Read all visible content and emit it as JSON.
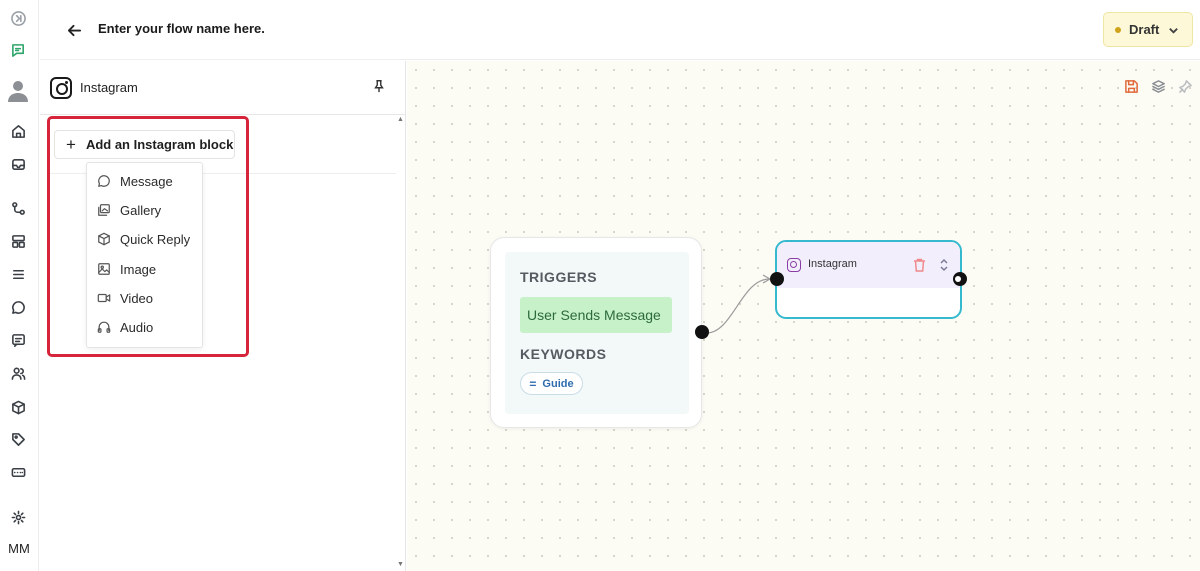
{
  "header": {
    "flow_name": "Enter your flow name here.",
    "status": "Draft"
  },
  "rail": {
    "user_initials": "MM"
  },
  "panel": {
    "title": "Instagram",
    "add_block_label": "Add an Instagram block",
    "block_types": [
      {
        "label": "Message",
        "icon": "message-icon"
      },
      {
        "label": "Gallery",
        "icon": "gallery-icon"
      },
      {
        "label": "Quick Reply",
        "icon": "box-icon"
      },
      {
        "label": "Image",
        "icon": "image-icon"
      },
      {
        "label": "Video",
        "icon": "video-icon"
      },
      {
        "label": "Audio",
        "icon": "headphones-icon"
      }
    ]
  },
  "canvas": {
    "trigger_node": {
      "triggers_label": "TRIGGERS",
      "trigger": "User Sends Message",
      "keywords_label": "KEYWORDS",
      "keyword": "Guide"
    },
    "instagram_node": {
      "title": "Instagram"
    }
  },
  "colors": {
    "highlight": "#d6253a",
    "node_border": "#35b9cf",
    "trigger_badge": "#c7f2c9",
    "draft_badge": "#fdf9d8"
  }
}
